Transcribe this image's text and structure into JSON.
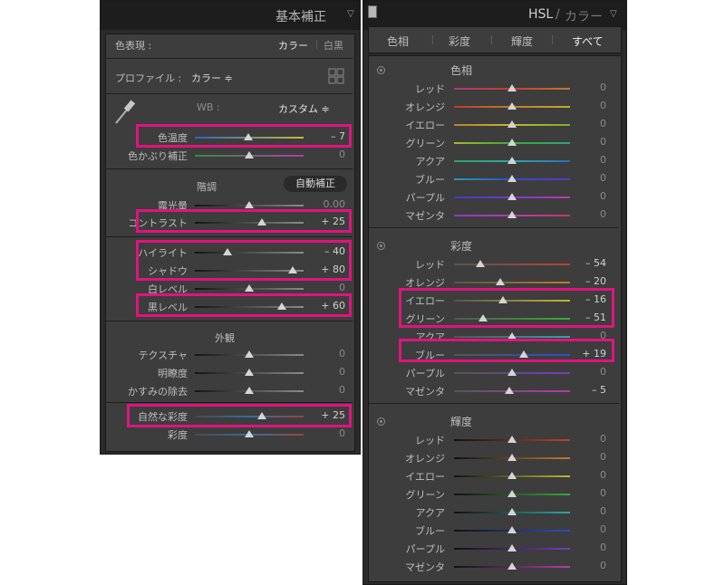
{
  "left": {
    "title": "基本補正",
    "treatment_label": "色表現 :",
    "treatment_color": "カラー",
    "treatment_bw": "白黒",
    "profile_label": "プロファイル :",
    "profile_value": "カラー ≑",
    "wb_label": "WB :",
    "wb_value": "カスタム ≑",
    "tone_label": "階調",
    "auto_label": "自動補正",
    "presence_label": "外観",
    "sliders": [
      {
        "label": "色温度",
        "value": "– 7",
        "pos": 0.49,
        "grad": "linear-gradient(90deg,#3560c8,#c9b93a)"
      },
      {
        "label": "色かぶり補正",
        "value": "0",
        "pos": 0.5,
        "grad": "linear-gradient(90deg,#2f8f3a,#b23ab2)"
      },
      {
        "label": "露光量",
        "value": "0.00",
        "pos": 0.5,
        "grad": "linear-gradient(90deg,#141414,#8a8a8a)"
      },
      {
        "label": "コントラスト",
        "value": "+ 25",
        "pos": 0.62,
        "grad": "linear-gradient(90deg,#141414,#8a8a8a)"
      },
      {
        "label": "ハイライト",
        "value": "– 40",
        "pos": 0.3,
        "grad": "linear-gradient(90deg,#141414,#8a8a8a)"
      },
      {
        "label": "シャドウ",
        "value": "+ 80",
        "pos": 0.9,
        "grad": "linear-gradient(90deg,#141414,#8a8a8a)"
      },
      {
        "label": "白レベル",
        "value": "0",
        "pos": 0.5,
        "grad": "linear-gradient(90deg,#141414,#8a8a8a)"
      },
      {
        "label": "黒レベル",
        "value": "+ 60",
        "pos": 0.8,
        "grad": "linear-gradient(90deg,#141414,#8a8a8a)"
      },
      {
        "label": "テクスチャ",
        "value": "0",
        "pos": 0.5,
        "grad": "linear-gradient(90deg,#141414,#8a8a8a)"
      },
      {
        "label": "明瞭度",
        "value": "0",
        "pos": 0.5,
        "grad": "linear-gradient(90deg,#141414,#8a8a8a)"
      },
      {
        "label": "かすみの除去",
        "value": "0",
        "pos": 0.5,
        "grad": "linear-gradient(90deg,#141414,#8a8a8a)"
      },
      {
        "label": "自然な彩度",
        "value": "+ 25",
        "pos": 0.62,
        "grad": "linear-gradient(90deg,#4a4a4a,#2f6f9f,#a04040)"
      },
      {
        "label": "彩度",
        "value": "0",
        "pos": 0.5,
        "grad": "linear-gradient(90deg,#4a4a4a,#2f6f9f,#a04040)"
      }
    ]
  },
  "right": {
    "title_hsl": "HSL",
    "title_sep": "/",
    "title_color": "カラー",
    "tabs": [
      "色相",
      "彩度",
      "輝度",
      "すべて"
    ],
    "groups": [
      {
        "title": "色相",
        "sliders": [
          {
            "label": "レッド",
            "value": "0",
            "pos": 0.5,
            "grad": "linear-gradient(90deg,#b03a7a,#c0402a,#c07a2a)"
          },
          {
            "label": "オレンジ",
            "value": "0",
            "pos": 0.5,
            "grad": "linear-gradient(90deg,#c03a2a,#c07a2a,#c0b02a)"
          },
          {
            "label": "イエロー",
            "value": "0",
            "pos": 0.5,
            "grad": "linear-gradient(90deg,#c0802a,#c0b82a,#7ab02a)"
          },
          {
            "label": "グリーン",
            "value": "0",
            "pos": 0.5,
            "grad": "linear-gradient(90deg,#a8b82a,#3aa83a,#2aa87a)"
          },
          {
            "label": "アクア",
            "value": "0",
            "pos": 0.5,
            "grad": "linear-gradient(90deg,#2aa860,#2aa8a8,#2a70c0)"
          },
          {
            "label": "ブルー",
            "value": "0",
            "pos": 0.5,
            "grad": "linear-gradient(90deg,#2a98b8,#2a50c8,#5a3ac0)"
          },
          {
            "label": "パープル",
            "value": "0",
            "pos": 0.5,
            "grad": "linear-gradient(90deg,#3a40c8,#7a3ac0,#b83ab0)"
          },
          {
            "label": "マゼンタ",
            "value": "0",
            "pos": 0.5,
            "grad": "linear-gradient(90deg,#8a3ac0,#b83ab0,#c03a60)"
          }
        ]
      },
      {
        "title": "彩度",
        "sliders": [
          {
            "label": "レッド",
            "value": "– 54",
            "pos": 0.23,
            "grad": "linear-gradient(90deg,#555555,#c0402a)"
          },
          {
            "label": "オレンジ",
            "value": "– 20",
            "pos": 0.4,
            "grad": "linear-gradient(90deg,#555555,#c07a2a)"
          },
          {
            "label": "イエロー",
            "value": "– 16",
            "pos": 0.42,
            "grad": "linear-gradient(90deg,#555555,#c0b82a)"
          },
          {
            "label": "グリーン",
            "value": "– 51",
            "pos": 0.25,
            "grad": "linear-gradient(90deg,#555555,#3aa83a)"
          },
          {
            "label": "アクア",
            "value": "0",
            "pos": 0.5,
            "grad": "linear-gradient(90deg,#555555,#2aa8a8)"
          },
          {
            "label": "ブルー",
            "value": "+ 19",
            "pos": 0.6,
            "grad": "linear-gradient(90deg,#555555,#2a50c8)"
          },
          {
            "label": "パープル",
            "value": "0",
            "pos": 0.5,
            "grad": "linear-gradient(90deg,#555555,#7a3ac0)"
          },
          {
            "label": "マゼンタ",
            "value": "– 5",
            "pos": 0.48,
            "grad": "linear-gradient(90deg,#555555,#b83ab0)"
          }
        ]
      },
      {
        "title": "輝度",
        "sliders": [
          {
            "label": "レッド",
            "value": "0",
            "pos": 0.5,
            "grad": "linear-gradient(90deg,#111111,#c0402a)"
          },
          {
            "label": "オレンジ",
            "value": "0",
            "pos": 0.5,
            "grad": "linear-gradient(90deg,#111111,#c07a2a)"
          },
          {
            "label": "イエロー",
            "value": "0",
            "pos": 0.5,
            "grad": "linear-gradient(90deg,#111111,#c0b82a)"
          },
          {
            "label": "グリーン",
            "value": "0",
            "pos": 0.5,
            "grad": "linear-gradient(90deg,#111111,#3aa83a)"
          },
          {
            "label": "アクア",
            "value": "0",
            "pos": 0.5,
            "grad": "linear-gradient(90deg,#111111,#2aa8a8)"
          },
          {
            "label": "ブルー",
            "value": "0",
            "pos": 0.5,
            "grad": "linear-gradient(90deg,#111111,#2a50c8)"
          },
          {
            "label": "パープル",
            "value": "0",
            "pos": 0.5,
            "grad": "linear-gradient(90deg,#111111,#7a3ac0)"
          },
          {
            "label": "マゼンタ",
            "value": "0",
            "pos": 0.5,
            "grad": "linear-gradient(90deg,#111111,#b83ab0)"
          }
        ]
      }
    ]
  },
  "highlight_color": "#e0147e"
}
